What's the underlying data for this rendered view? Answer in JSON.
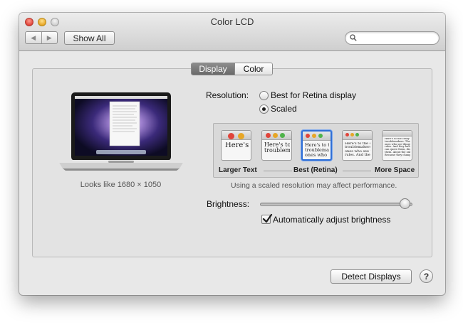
{
  "window": {
    "title": "Color LCD"
  },
  "toolbar": {
    "back_icon": "back-arrow-icon",
    "forward_icon": "forward-arrow-icon",
    "back_glyph": "◀",
    "forward_glyph": "▶",
    "show_all_label": "Show All",
    "search_placeholder": ""
  },
  "tabs": [
    {
      "label": "Display",
      "selected": true
    },
    {
      "label": "Color",
      "selected": false
    }
  ],
  "display_preview": {
    "caption": "Looks like 1680 × 1050"
  },
  "resolution": {
    "label": "Resolution:",
    "options": [
      {
        "label": "Best for Retina display",
        "selected": false
      },
      {
        "label": "Scaled",
        "selected": true
      }
    ]
  },
  "scaled": {
    "thumbnails": [
      {
        "text": "Here's",
        "selected": false
      },
      {
        "text": "Here's to\ntroublem",
        "selected": false
      },
      {
        "text": "Here's to th\ntroublemak\nones who",
        "selected": true
      },
      {
        "text": "Here's to the c\ntroublemakers.\nones who see t\nrules. And they",
        "selected": false
      },
      {
        "text": "Here's to the crazy one\ntroublemakers. The rou\nones who see things dif\nrules. And they have no\ncan quote them, disagr\nthem. About the only th\nBecause they change th",
        "selected": false
      }
    ],
    "label_left": "Larger Text",
    "label_center": "Best (Retina)",
    "label_right": "More Space",
    "note": "Using a scaled resolution may affect performance."
  },
  "brightness": {
    "label": "Brightness:",
    "level": 0.98,
    "auto_label": "Automatically adjust brightness",
    "auto_checked": true
  },
  "footer": {
    "detect_label": "Detect Displays",
    "help_label": "?"
  },
  "colors": {
    "accent": "#2f6fd6",
    "window_bg": "#e8e8e8"
  }
}
